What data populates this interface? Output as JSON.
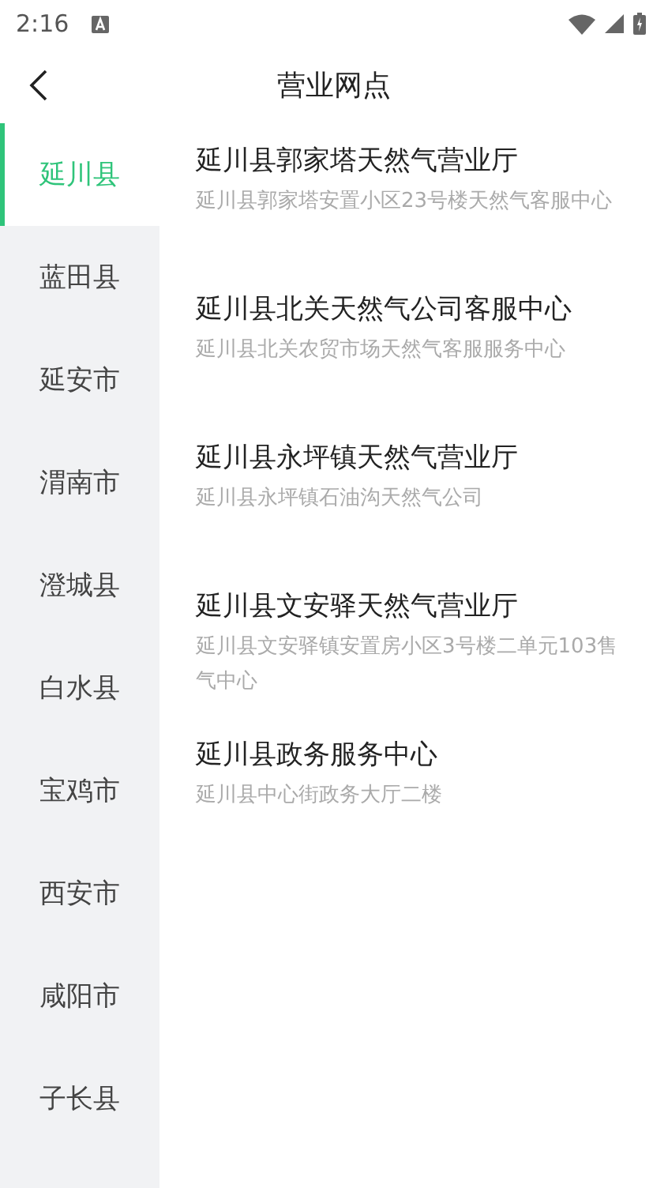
{
  "status_bar": {
    "time": "2:16"
  },
  "header": {
    "title": "营业网点"
  },
  "sidebar": {
    "items": [
      {
        "label": "延川县",
        "selected": true
      },
      {
        "label": "蓝田县",
        "selected": false
      },
      {
        "label": "延安市",
        "selected": false
      },
      {
        "label": "渭南市",
        "selected": false
      },
      {
        "label": "澄城县",
        "selected": false
      },
      {
        "label": "白水县",
        "selected": false
      },
      {
        "label": "宝鸡市",
        "selected": false
      },
      {
        "label": "西安市",
        "selected": false
      },
      {
        "label": "咸阳市",
        "selected": false
      },
      {
        "label": "子长县",
        "selected": false
      }
    ]
  },
  "offices": [
    {
      "name": "延川县郭家塔天然气营业厅",
      "address": "延川县郭家塔安置小区23号楼天然气客服中心"
    },
    {
      "name": "延川县北关天然气公司客服中心",
      "address": "延川县北关农贸市场天然气客服服务中心"
    },
    {
      "name": "延川县永坪镇天然气营业厅",
      "address": "延川县永坪镇石油沟天然气公司"
    },
    {
      "name": "延川县文安驿天然气营业厅",
      "address": "延川县文安驿镇安置房小区3号楼二单元103售气中心"
    },
    {
      "name": "延川县政务服务中心",
      "address": "延川县中心街政务大厅二楼"
    }
  ]
}
